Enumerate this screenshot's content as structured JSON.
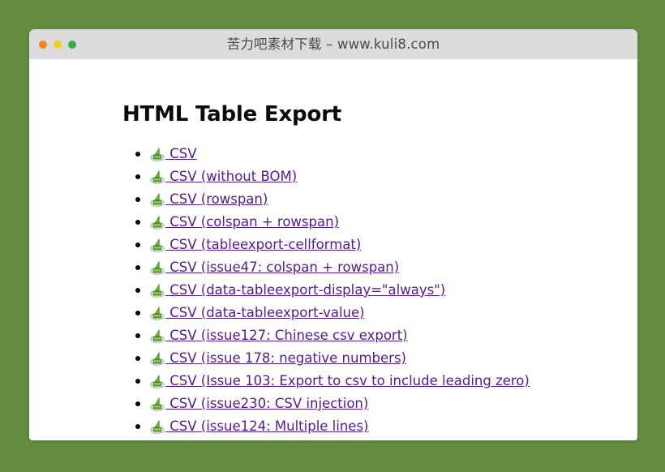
{
  "window": {
    "title": "苦力吧素材下载 – www.kuli8.com",
    "traffic_lights": [
      {
        "name": "close",
        "color": "#f58220"
      },
      {
        "name": "minimize",
        "color": "#f3d019"
      },
      {
        "name": "maximize",
        "color": "#2fb344"
      }
    ]
  },
  "page": {
    "heading": "HTML Table Export",
    "link_color": "#551a8b",
    "background_color": "#648c41",
    "title_bar_color": "#dcdcdc",
    "content_color": "#ffffff",
    "icon_name": "csv-export-icon",
    "links": [
      {
        "label": " CSV"
      },
      {
        "label": " CSV (without BOM)"
      },
      {
        "label": " CSV (rowspan)"
      },
      {
        "label": " CSV (colspan + rowspan)"
      },
      {
        "label": " CSV (tableexport-cellformat)"
      },
      {
        "label": " CSV (issue47: colspan + rowspan)"
      },
      {
        "label": " CSV (data-tableexport-display=\"always\")"
      },
      {
        "label": " CSV (data-tableexport-value)"
      },
      {
        "label": " CSV (issue127: Chinese csv export)"
      },
      {
        "label": " CSV (issue 178: negative numbers)"
      },
      {
        "label": " CSV (Issue 103: Export to csv to include leading zero)"
      },
      {
        "label": " CSV (issue230: CSV injection)"
      },
      {
        "label": " CSV (issue124: Multiple lines)"
      }
    ]
  }
}
